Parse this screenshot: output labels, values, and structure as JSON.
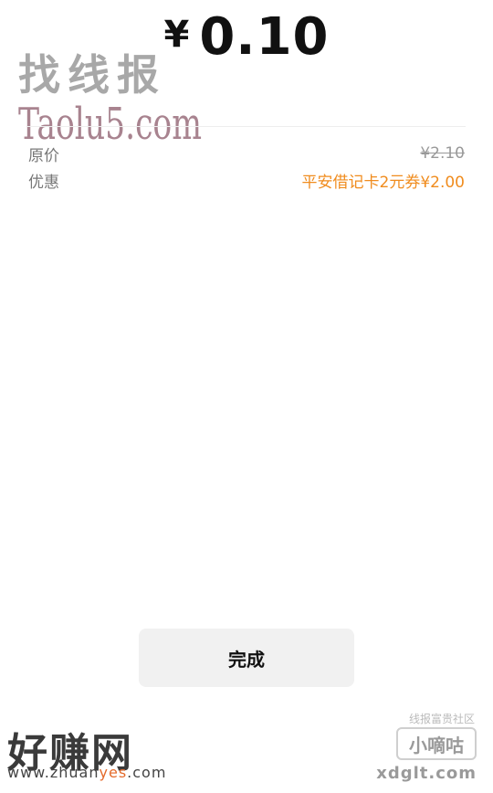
{
  "payment": {
    "currency_symbol": "¥",
    "amount": "0.10"
  },
  "details": {
    "original_label": "原价",
    "original_value": "¥2.10",
    "discount_label": "优惠",
    "discount_value": "平安借记卡2元券¥2.00"
  },
  "actions": {
    "done_label": "完成"
  },
  "watermarks": {
    "top_cn": "找线报",
    "top_en": "Taolu5.com",
    "bottom_left_cn": "好赚网",
    "bottom_left_url_pre": "www.zhuan",
    "bottom_left_url_hl": "yes",
    "bottom_left_url_post": ".com",
    "bottom_right_top": "线报富贵社区",
    "bottom_right_box": "小嘀咕",
    "bottom_right_url": "xdglt.com"
  },
  "colors": {
    "promo": "#f08c1e",
    "button_bg": "#f1f1f1"
  }
}
